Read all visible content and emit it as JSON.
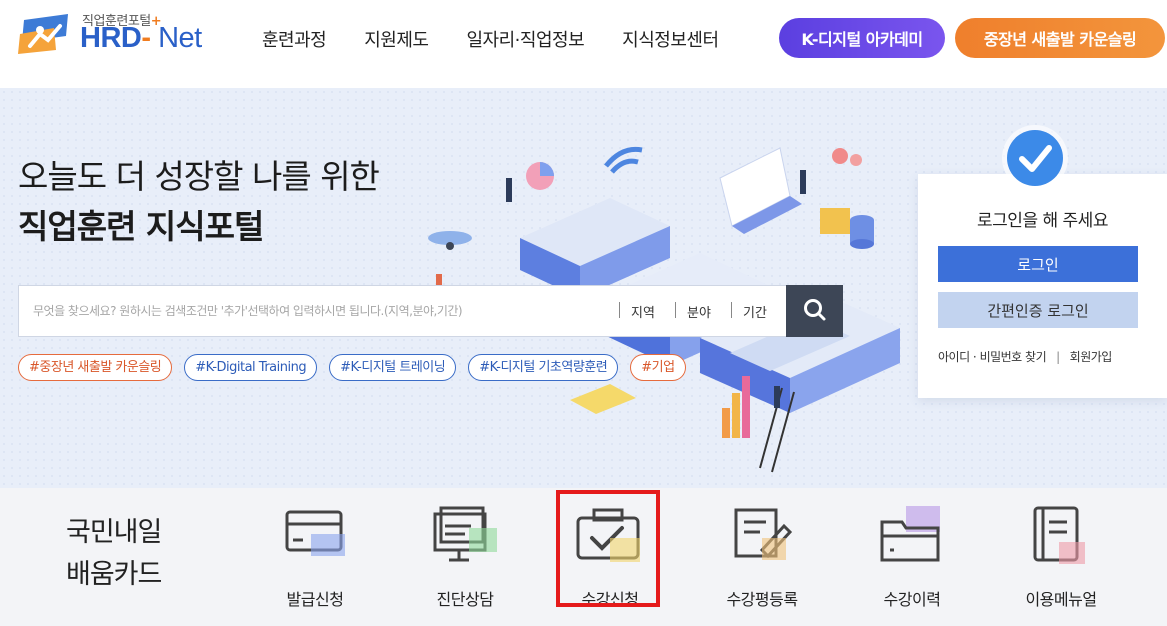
{
  "header": {
    "logo_sub": "직업훈련포털",
    "logo_plus": "+",
    "logo_hrd": "HRD",
    "logo_dash": "-",
    "logo_net": " Net",
    "nav": [
      "훈련과정",
      "지원제도",
      "일자리·직업정보",
      "지식정보센터"
    ],
    "btn_kdigital": "K-디지털 아카데미",
    "btn_counsel": "중장년 새출발 카운슬링"
  },
  "hero": {
    "title_line1": "오늘도 더 성장할 나를 위한",
    "title_line2": "직업훈련 지식포털",
    "search_placeholder": "무엇을 찾으세요? 원하시는 검색조건만 '추가'선택하여 입력하시면 됩니다.(지역,분야,기간)",
    "filters": [
      "지역",
      "분야",
      "기간"
    ],
    "search_icon": "search-icon",
    "tags": [
      "#중장년 새출발 카운슬링",
      "#K-Digital Training",
      "#K-디지털 트레이닝",
      "#K-디지털 기초역량훈련",
      "#기업"
    ]
  },
  "login": {
    "message": "로그인을 해 주세요",
    "login_button": "로그인",
    "cert_button": "간편인증 로그인",
    "find_link": "아이디 · 비밀번호 찾기",
    "separator": "|",
    "join_link": "회원가입"
  },
  "card": {
    "title_line1": "국민내일",
    "title_line2": "배움카드",
    "services": [
      {
        "label": "발급신청",
        "icon": "card-icon"
      },
      {
        "label": "진단상담",
        "icon": "consult-icon"
      },
      {
        "label": "수강신청",
        "icon": "enroll-check-icon"
      },
      {
        "label": "수강평등록",
        "icon": "review-pencil-icon"
      },
      {
        "label": "수강이력",
        "icon": "folder-history-icon"
      },
      {
        "label": "이용메뉴얼",
        "icon": "manual-book-icon"
      }
    ]
  },
  "colors": {
    "brand_blue": "#2a60c8",
    "brand_orange": "#f07c1f",
    "kdigital_purple": "#6a4be8",
    "login_blue": "#3c70d9",
    "highlight_red": "#e51b1b"
  }
}
